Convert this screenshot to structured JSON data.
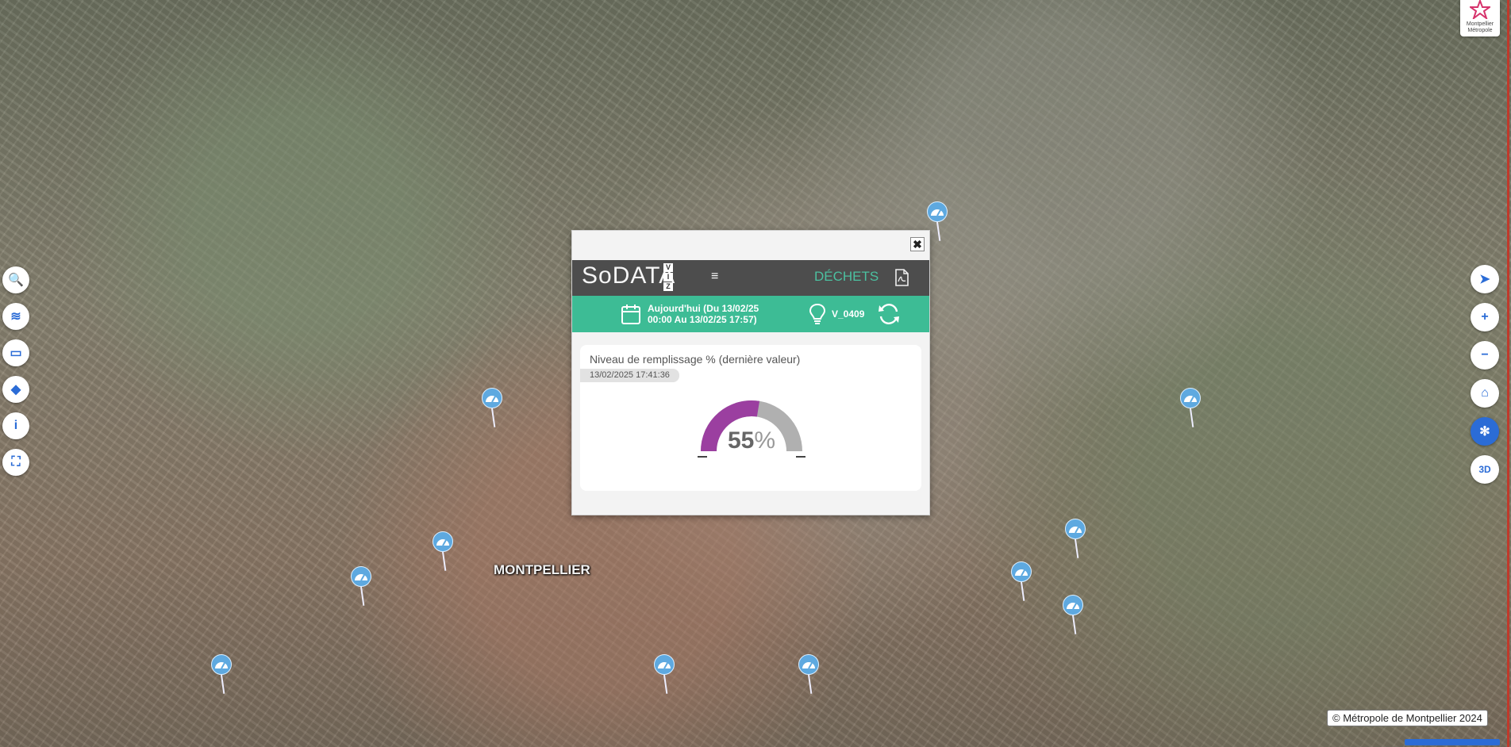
{
  "map": {
    "city_label": "MONTPELLIER",
    "copyright": "© Métropole de Montpellier 2024",
    "logo_text": "Montpellier\nMétropole",
    "marker_icon": "gauge-icon",
    "marker_color": "#5ea9e0"
  },
  "left_toolbar": [
    {
      "name": "search-icon",
      "glyph": "🔍"
    },
    {
      "name": "layers-icon",
      "glyph": "≋"
    },
    {
      "name": "ruler-icon",
      "glyph": "▭"
    },
    {
      "name": "cube-icon",
      "glyph": "◆"
    },
    {
      "name": "info-icon",
      "glyph": "i"
    },
    {
      "name": "fullscreen-icon",
      "glyph": "⛶"
    }
  ],
  "right_toolbar": [
    {
      "name": "north-arrow-icon",
      "glyph": "➤"
    },
    {
      "name": "zoom-in-icon",
      "glyph": "+"
    },
    {
      "name": "zoom-out-icon",
      "glyph": "−"
    },
    {
      "name": "home-icon",
      "glyph": "⌂"
    },
    {
      "name": "settings-icon",
      "glyph": "✻"
    },
    {
      "name": "3d-toggle",
      "glyph": "3D"
    }
  ],
  "popup": {
    "close": "✖",
    "logo": "SoDATA",
    "logo_sub": [
      "V",
      "I",
      "Z"
    ],
    "menu": "≡",
    "module": "DÉCHETS",
    "date_line1": "Aujourd'hui (Du 13/02/25",
    "date_line2": "00:00 Au 13/02/25 17:57)",
    "device": "V_0409",
    "card": {
      "title": "Niveau de remplissage % (dernière valeur)",
      "timestamp": "13/02/2025 17:41:36",
      "value": "55",
      "unit": "%",
      "fill_fraction": 0.55,
      "fill_color": "#9b3fa0",
      "empty_color": "#b0b0b0"
    }
  },
  "colors": {
    "accent_green": "#3dbc95",
    "header_gray": "#4d4d4d",
    "button_blue": "#2b6cd6"
  }
}
